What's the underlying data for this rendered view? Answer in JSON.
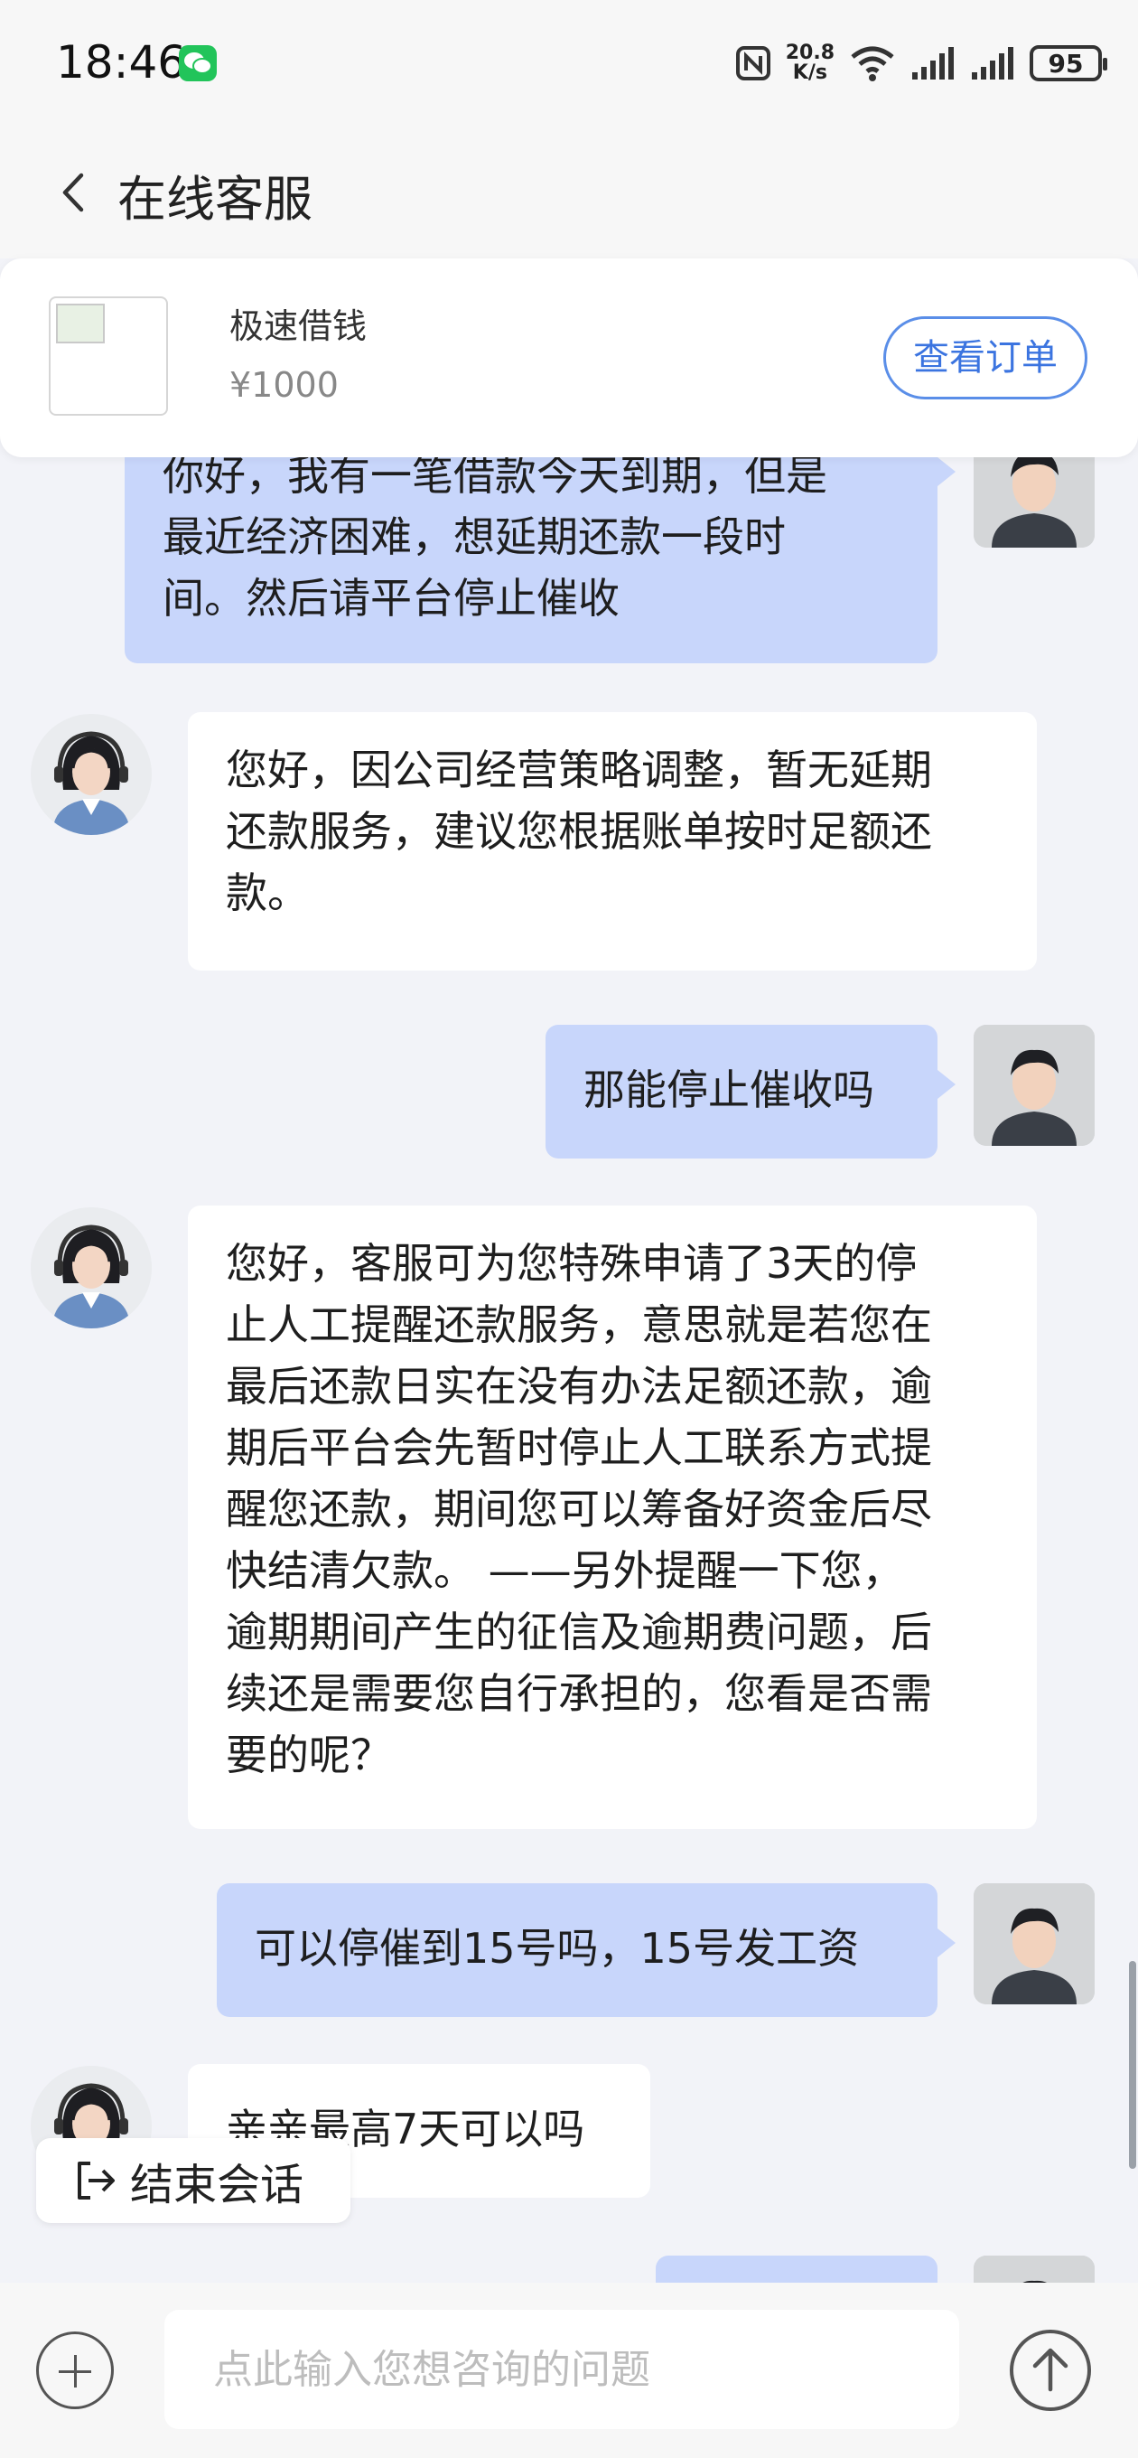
{
  "status_bar": {
    "time": "18:46",
    "network_speed_value": "20.8",
    "network_speed_unit": "K/s",
    "battery": "95"
  },
  "nav": {
    "title": "在线客服"
  },
  "order": {
    "product_name": "极速借钱",
    "price": "¥1000",
    "view_order_label": "查看订单"
  },
  "messages": [
    {
      "from": "user",
      "lines": [
        "你好，我有一笔借款今天到期，但是",
        "最近经济困难，想延期还款一段时",
        "间。然后请平台停止催收"
      ]
    },
    {
      "from": "agent",
      "lines": [
        "您好，因公司经营策略调整，暂无延期",
        "还款服务，建议您根据账单按时足额还",
        "款。"
      ]
    },
    {
      "from": "user",
      "lines": [
        "那能停止催收吗"
      ]
    },
    {
      "from": "agent",
      "lines": [
        "您好，客服可为您特殊申请了3天的停",
        "止人工提醒还款服务，意思就是若您在",
        "最后还款日实在没有办法足额还款，逾",
        "期后平台会先暂时停止人工联系方式提",
        "醒您还款，期间您可以筹备好资金后尽",
        "快结清欠款。 ——另外提醒一下您，",
        "逾期期间产生的征信及逾期费问题，后",
        "续还是需要您自行承担的，您看是否需",
        "要的呢？"
      ]
    },
    {
      "from": "user",
      "lines": [
        "可以停催到15号吗，15号发工资"
      ]
    },
    {
      "from": "agent",
      "lines": [
        "亲亲最高7天可以吗"
      ]
    }
  ],
  "end_session_label": "结束会话",
  "input": {
    "placeholder": "点此输入您想咨询的问题"
  },
  "colors": {
    "user_bubble": "#c8d6fb",
    "agent_bubble": "#ffffff",
    "accent": "#3b74e0",
    "background": "#f2f3f8"
  }
}
